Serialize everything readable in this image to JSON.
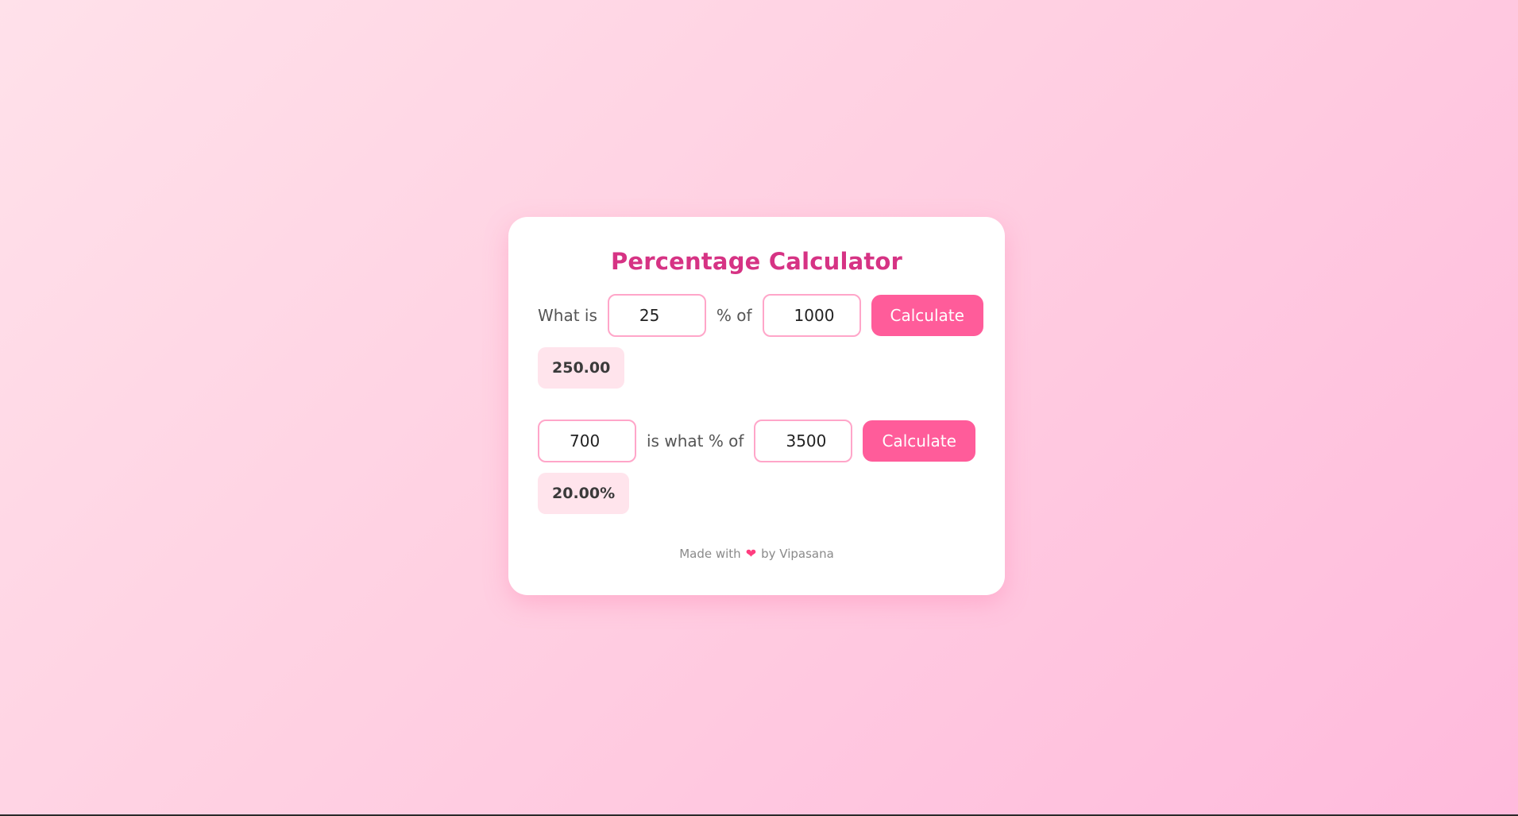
{
  "title": "Percentage Calculator",
  "calc1": {
    "prefix": "What is",
    "percent_value": "25",
    "middle": "% of",
    "base_value": "1000",
    "button": "Calculate",
    "result": "250.00"
  },
  "calc2": {
    "part_value": "700",
    "middle": "is what % of",
    "whole_value": "3500",
    "button": "Calculate",
    "result": "20.00%"
  },
  "footer": {
    "prefix": "Made with",
    "heart": "❤",
    "suffix": "by Vipasana"
  },
  "colors": {
    "accent": "#ff5c9a",
    "title": "#d63384",
    "result_bg": "#ffe4ec",
    "input_border": "#ffa6c9"
  }
}
